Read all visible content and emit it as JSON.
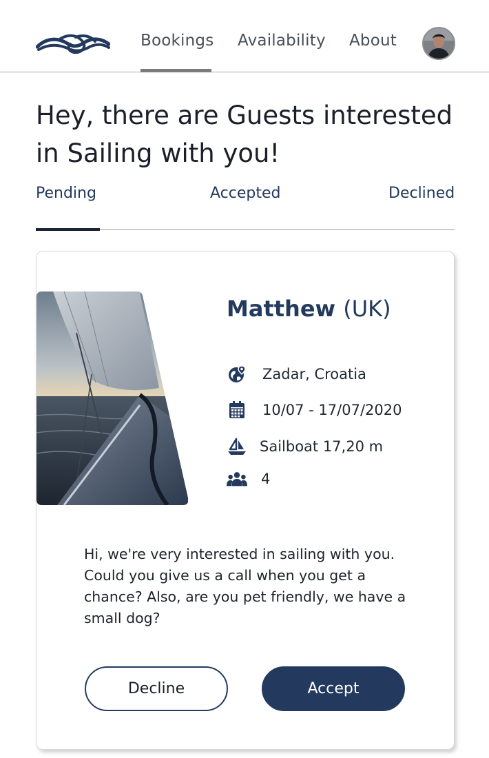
{
  "nav": {
    "links": [
      {
        "label": "Bookings",
        "active": true
      },
      {
        "label": "Availability",
        "active": false
      },
      {
        "label": "About",
        "active": false
      }
    ]
  },
  "heading": "Hey, there are Guests interested in Sailing with you!",
  "tabs": [
    {
      "label": "Pending",
      "active": true
    },
    {
      "label": "Accepted",
      "active": false
    },
    {
      "label": "Declined",
      "active": false
    }
  ],
  "booking": {
    "guest_name": "Matthew",
    "guest_country": "(UK)",
    "location": "Zadar, Croatia",
    "dates": "10/07 - 17/07/2020",
    "boat": "Sailboat 17,20 m",
    "guests": "4",
    "message": "Hi, we're very interested in sailing with you. Could you give us a call when you get a chance? Also, are you pet friendly, we have a small dog?",
    "decline_label": "Decline",
    "accept_label": "Accept"
  },
  "colors": {
    "primary": "#233a5e",
    "text": "#1b1f2a",
    "nav_text": "#4a4f57",
    "divider": "#9a9a9a"
  },
  "icons": [
    "wave-logo-icon",
    "globe-pin-icon",
    "calendar-icon",
    "sailboat-icon",
    "group-icon"
  ]
}
